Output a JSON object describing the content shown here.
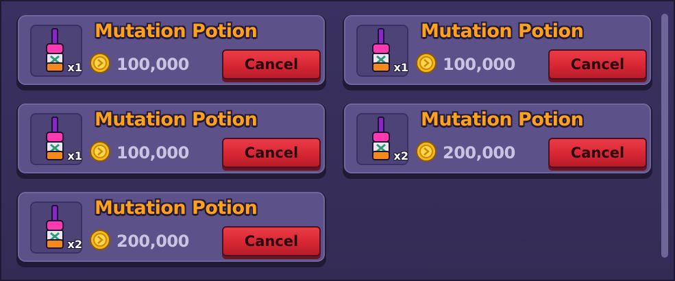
{
  "listings": [
    {
      "title": "Mutation Potion",
      "quantity": "x1",
      "price": "100,000",
      "button": "Cancel"
    },
    {
      "title": "Mutation Potion",
      "quantity": "x1",
      "price": "100,000",
      "button": "Cancel"
    },
    {
      "title": "Mutation Potion",
      "quantity": "x1",
      "price": "100,000",
      "button": "Cancel"
    },
    {
      "title": "Mutation Potion",
      "quantity": "x2",
      "price": "200,000",
      "button": "Cancel"
    },
    {
      "title": "Mutation Potion",
      "quantity": "x2",
      "price": "200,000",
      "button": "Cancel"
    }
  ],
  "icons": {
    "item": "potion-bottle-icon",
    "currency": "gold-coin-icon"
  },
  "colors": {
    "title": "#ffa11a",
    "cancel": "#d42632",
    "card": "#5c5189",
    "panel": "#342b55"
  }
}
